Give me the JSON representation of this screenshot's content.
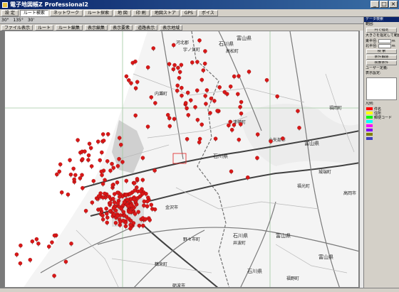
{
  "window": {
    "title": "電子地図帳Z Professional2"
  },
  "toolbar": {
    "items": [
      "設 定",
      "ルート検索",
      "ネットワーク",
      "ルート探索",
      "地 図",
      "印 刷",
      "地図ストア",
      "GPS",
      "ボイス"
    ]
  },
  "coords": {
    "values": [
      "30\"",
      "135°",
      "30'"
    ]
  },
  "subbar": {
    "items": [
      "ファイル表示",
      "ルート",
      "ルート編集",
      "表示編集",
      "表示要素",
      "道路表示",
      "表示地域"
    ]
  },
  "panel": {
    "title": "データ検索",
    "label_range": "範囲:",
    "btn_range": "円で指定",
    "label_size": "大きさを指定して範囲:",
    "label_east": "東半径:",
    "label_north": "北半径:",
    "unit": "m",
    "btn_search": "検 索",
    "btn_clear": "条件解除",
    "btn_cond": "検索条件",
    "label_user": "ユーザー定義:",
    "label_attr": "表示設定:",
    "legend_title": "凡例:",
    "legend": [
      {
        "label": "件名",
        "color": "#ff0000"
      },
      {
        "label": "住所",
        "color": "#ffff00"
      },
      {
        "label": "郵便コード",
        "color": "#00ff00"
      },
      {
        "label": "",
        "color": "#00ffff"
      },
      {
        "label": "",
        "color": "#ff00ff"
      },
      {
        "label": "",
        "color": "#8000ff"
      },
      {
        "label": "",
        "color": "#808000"
      },
      {
        "label": "",
        "color": "#4040c0"
      }
    ]
  },
  "map": {
    "prefecture_labels": [
      "石川県",
      "富山県",
      "富山県",
      "石川県",
      "石川県",
      "富山県",
      "石川県",
      "富山県"
    ],
    "place_labels": [
      "河北郡",
      "宇ノ気町",
      "高松町",
      "内灘町",
      "津幡町",
      "小矢部市",
      "福光町",
      "城端町",
      "金沢市",
      "野々市町",
      "鶴来町",
      "砺波市",
      "井波町",
      "福野町",
      "福岡町",
      "高岡市"
    ],
    "marker_color": "#d81818",
    "marker_count": 300
  }
}
